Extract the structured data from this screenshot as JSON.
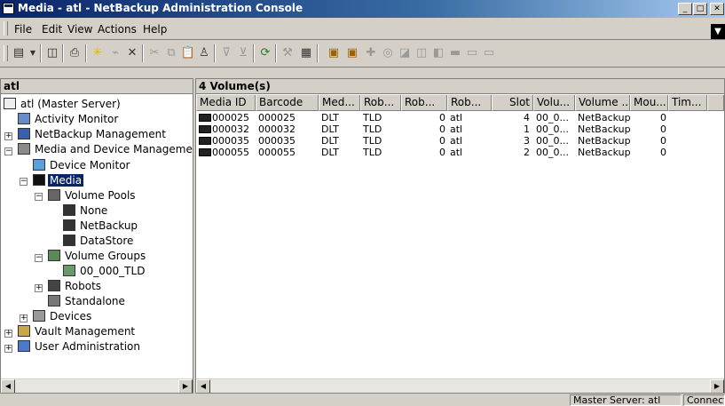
{
  "window": {
    "title": "Media - atl - NetBackup Administration Console"
  },
  "menu": {
    "items": [
      "File",
      "Edit",
      "View",
      "Actions",
      "Help"
    ]
  },
  "tree": {
    "header": "atl",
    "nodes": [
      {
        "label": "atl (Master Server)",
        "icon": "server-icon"
      },
      {
        "label": "Activity Monitor",
        "icon": "monitor-icon"
      },
      {
        "label": "NetBackup Management",
        "icon": "netbackup-icon"
      },
      {
        "label": "Media and Device Management",
        "icon": "device-management-icon"
      },
      {
        "label": "Device Monitor",
        "icon": "device-monitor-icon"
      },
      {
        "label": "Media",
        "icon": "media-icon"
      },
      {
        "label": "Volume Pools",
        "icon": "volume-pools-icon"
      },
      {
        "label": "None",
        "icon": "pool-icon"
      },
      {
        "label": "NetBackup",
        "icon": "pool-icon"
      },
      {
        "label": "DataStore",
        "icon": "pool-icon"
      },
      {
        "label": "Volume Groups",
        "icon": "volume-groups-icon"
      },
      {
        "label": "00_000_TLD",
        "icon": "volume-group-icon"
      },
      {
        "label": "Robots",
        "icon": "robot-icon"
      },
      {
        "label": "Standalone",
        "icon": "standalone-icon"
      },
      {
        "label": "Devices",
        "icon": "devices-icon"
      },
      {
        "label": "Vault Management",
        "icon": "vault-icon"
      },
      {
        "label": "User Administration",
        "icon": "users-icon"
      }
    ]
  },
  "details": {
    "header": "4 Volume(s)",
    "columns": [
      "Media ID",
      "Barcode",
      "Med...",
      "Rob...",
      "Rob...",
      "Rob...",
      "Slot",
      "Volu...",
      "Volume ...",
      "Mou...",
      "Tim..."
    ],
    "rows": [
      [
        "000025",
        "000025",
        "DLT",
        "TLD",
        "0",
        "atl",
        "4",
        "00_0...",
        "NetBackup",
        "0",
        ""
      ],
      [
        "000032",
        "000032",
        "DLT",
        "TLD",
        "0",
        "atl",
        "1",
        "00_0...",
        "NetBackup",
        "0",
        ""
      ],
      [
        "000035",
        "000035",
        "DLT",
        "TLD",
        "0",
        "atl",
        "3",
        "00_0...",
        "NetBackup",
        "0",
        ""
      ],
      [
        "000055",
        "000055",
        "DLT",
        "TLD",
        "0",
        "atl",
        "2",
        "00_0...",
        "NetBackup",
        "0",
        ""
      ]
    ]
  },
  "status": {
    "server": "Master Server: atl",
    "connection": "Connected"
  }
}
